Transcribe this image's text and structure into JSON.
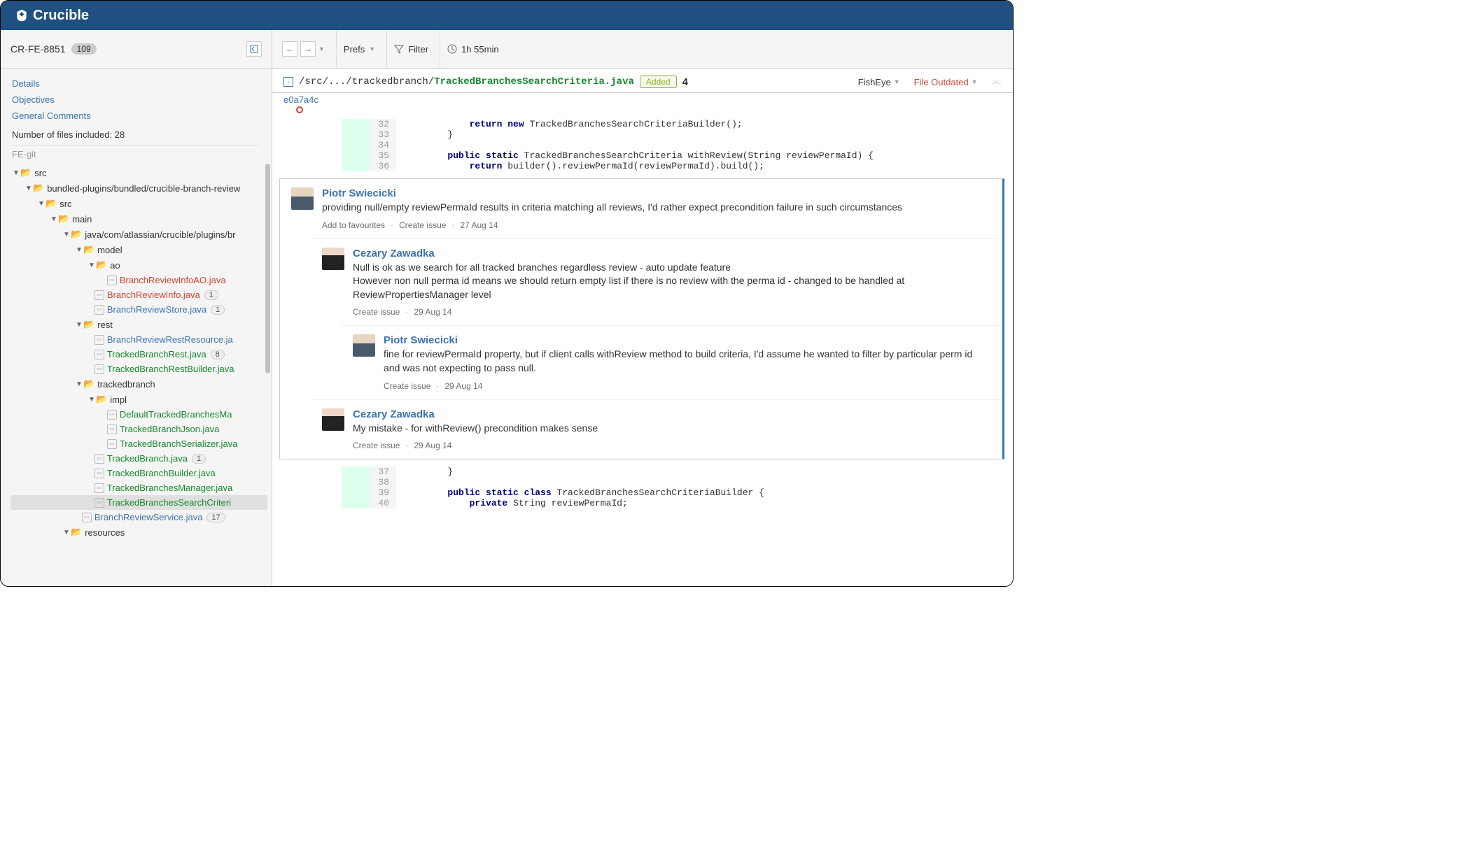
{
  "app_name": "Crucible",
  "sidebar": {
    "review_id": "CR-FE-8851",
    "review_count": "109",
    "nav": {
      "details": "Details",
      "objectives": "Objectives",
      "general_comments": "General Comments"
    },
    "files_included": "Number of files included: 28",
    "repo": "FE-git",
    "tree": {
      "n0": "src",
      "n1": "bundled-plugins/bundled/crucible-branch-review",
      "n2": "src",
      "n3": "main",
      "n4": "java/com/atlassian/crucible/plugins/br",
      "n5": "model",
      "n6": "ao",
      "n7": "BranchReviewInfoAO.java",
      "n8": "BranchReviewInfo.java",
      "n8b": "1",
      "n9": "BranchReviewStore.java",
      "n9b": "1",
      "n10": "rest",
      "n11": "BranchReviewRestResource.ja",
      "n12": "TrackedBranchRest.java",
      "n12b": "8",
      "n13": "TrackedBranchRestBuilder.java",
      "n14": "trackedbranch",
      "n15": "impl",
      "n16": "DefaultTrackedBranchesMa",
      "n17": "TrackedBranchJson.java",
      "n18": "TrackedBranchSerializer.java",
      "n19": "TrackedBranch.java",
      "n19b": "1",
      "n20": "TrackedBranchBuilder.java",
      "n21": "TrackedBranchesManager.java",
      "n22": "TrackedBranchesSearchCriteri",
      "n23": "BranchReviewService.java",
      "n23b": "17",
      "n24": "resources"
    }
  },
  "toolbar": {
    "prefs": "Prefs",
    "filter": "Filter",
    "time": "1h 55min"
  },
  "file": {
    "path_prefix": "/src/.../trackedbranch/",
    "path_name": "TrackedBranchesSearchCriteria.java",
    "status": "Added",
    "comment_count": "4",
    "fisheye": "FishEye",
    "outdated": "File Outdated",
    "commit": "e0a7a4c"
  },
  "code": {
    "l32n": "32",
    "l32": "            return new TrackedBranchesSearchCriteriaBuilder();",
    "l33n": "33",
    "l33": "        }",
    "l34n": "34",
    "l34": "",
    "l35n": "35",
    "l35": "        public static TrackedBranchesSearchCriteria withReview(String reviewPermaId) {",
    "l36n": "36",
    "l36": "            return builder().reviewPermaId(reviewPermaId).build();",
    "l37n": "37",
    "l37": "        }",
    "l38n": "38",
    "l38": "",
    "l39n": "39",
    "l39": "        public static class TrackedBranchesSearchCriteriaBuilder {",
    "l40n": "40",
    "l40": "            private String reviewPermaId;"
  },
  "comments": {
    "c1": {
      "author": "Piotr Swiecicki",
      "text": "providing null/empty reviewPermaId results in criteria matching all reviews, I'd rather expect precondition failure in such circumstances",
      "fav": "Add to favourites",
      "issue": "Create issue",
      "date": "27 Aug 14"
    },
    "c2": {
      "author": "Cezary Zawadka",
      "text1": "Null is ok as we search for all tracked branches regardless review - auto update feature",
      "text2": "However non null perma id means we should return empty list if there is no review with the perma id - changed to be handled at ReviewPropertiesManager level",
      "issue": "Create issue",
      "date": "29 Aug 14"
    },
    "c3": {
      "author": "Piotr Swiecicki",
      "text": "fine for reviewPermaId property, but if client calls withReview method to build criteria, I'd assume he wanted to filter by particular perm id and was not expecting to pass null.",
      "issue": "Create issue",
      "date": "29 Aug 14"
    },
    "c4": {
      "author": "Cezary Zawadka",
      "text": "My mistake - for withReview() precondition makes sense",
      "issue": "Create issue",
      "date": "29 Aug 14"
    }
  }
}
